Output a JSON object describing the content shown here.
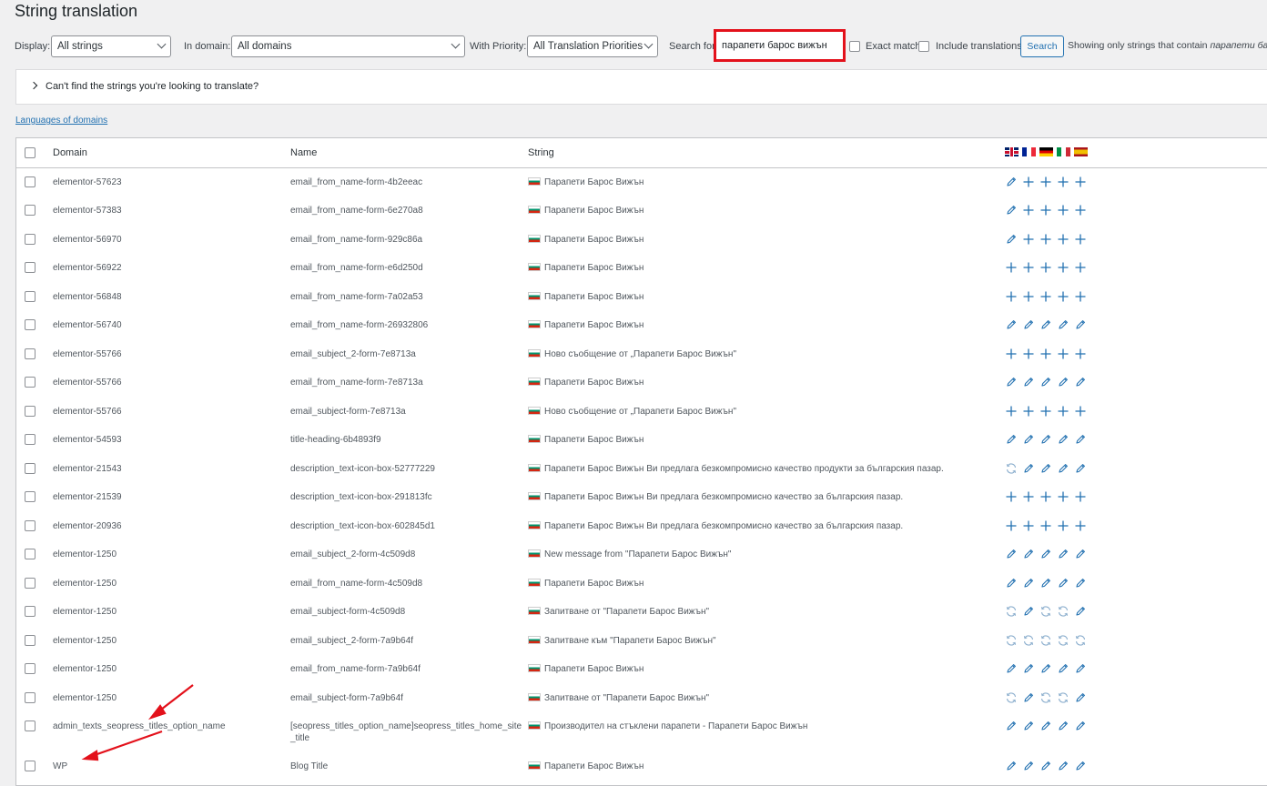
{
  "page": {
    "title": "String translation"
  },
  "filters": {
    "display_label": "Display:",
    "display_value": "All strings",
    "domain_label": "In domain:",
    "domain_value": "All domains",
    "priority_label": "With Priority:",
    "priority_value": "All Translation Priorities",
    "search_label": "Search for:",
    "search_value": "парапети барос вижън",
    "exact_match_label": "Exact match",
    "include_translations_label": "Include translations",
    "search_button": "Search",
    "result_note_prefix": "Showing only strings that contain",
    "result_note_term": "парапети ба"
  },
  "notice": {
    "text": "Can't find the strings you're looking to translate?"
  },
  "languages_link": "Languages of domains",
  "table": {
    "columns": {
      "domain": "Domain",
      "name": "Name",
      "string": "String"
    },
    "language_flags": [
      "gb-flag",
      "fr-flag",
      "de-flag",
      "it-flag",
      "es-flag"
    ],
    "rows": [
      {
        "domain": "elementor-57623",
        "name": "email_from_name-form-4b2eeac",
        "string": "Парапети Барос Вижън",
        "actions": [
          "edit",
          "add",
          "add",
          "add",
          "add"
        ]
      },
      {
        "domain": "elementor-57383",
        "name": "email_from_name-form-6e270a8",
        "string": "Парапети Барос Вижън",
        "actions": [
          "edit",
          "add",
          "add",
          "add",
          "add"
        ]
      },
      {
        "domain": "elementor-56970",
        "name": "email_from_name-form-929c86a",
        "string": "Парапети Барос Вижън",
        "actions": [
          "edit",
          "add",
          "add",
          "add",
          "add"
        ]
      },
      {
        "domain": "elementor-56922",
        "name": "email_from_name-form-e6d250d",
        "string": "Парапети Барос Вижън",
        "actions": [
          "add",
          "add",
          "add",
          "add",
          "add"
        ]
      },
      {
        "domain": "elementor-56848",
        "name": "email_from_name-form-7a02a53",
        "string": "Парапети Барос Вижън",
        "actions": [
          "add",
          "add",
          "add",
          "add",
          "add"
        ]
      },
      {
        "domain": "elementor-56740",
        "name": "email_from_name-form-26932806",
        "string": "Парапети Барос Вижън",
        "actions": [
          "edit",
          "edit",
          "edit",
          "edit",
          "edit"
        ]
      },
      {
        "domain": "elementor-55766",
        "name": "email_subject_2-form-7e8713a",
        "string": "Ново съобщение от „Парапети Барос Вижън\"",
        "actions": [
          "add",
          "add",
          "add",
          "add",
          "add"
        ]
      },
      {
        "domain": "elementor-55766",
        "name": "email_from_name-form-7e8713a",
        "string": "Парапети Барос Вижън",
        "actions": [
          "edit",
          "edit",
          "edit",
          "edit",
          "edit"
        ]
      },
      {
        "domain": "elementor-55766",
        "name": "email_subject-form-7e8713a",
        "string": "Ново съобщение от „Парапети Барос Вижън\"",
        "actions": [
          "add",
          "add",
          "add",
          "add",
          "add"
        ]
      },
      {
        "domain": "elementor-54593",
        "name": "title-heading-6b4893f9",
        "string": "Парапети Барос Вижън",
        "actions": [
          "edit",
          "edit",
          "edit",
          "edit",
          "edit"
        ]
      },
      {
        "domain": "elementor-21543",
        "name": "description_text-icon-box-52777229",
        "string": "Парапети Барос Вижън Ви предлага безкомпромисно качество продукти за българския пазар.",
        "actions": [
          "sync",
          "edit",
          "edit",
          "edit",
          "edit"
        ]
      },
      {
        "domain": "elementor-21539",
        "name": "description_text-icon-box-291813fc",
        "string": "Парапети Барос Вижън Ви предлага безкомпромисно качество за българския пазар.",
        "actions": [
          "add",
          "add",
          "add",
          "add",
          "add"
        ]
      },
      {
        "domain": "elementor-20936",
        "name": "description_text-icon-box-602845d1",
        "string": "Парапети Барос Вижън Ви предлага безкомпромисно качество за българския пазар.",
        "actions": [
          "add",
          "add",
          "add",
          "add",
          "add"
        ]
      },
      {
        "domain": "elementor-1250",
        "name": "email_subject_2-form-4c509d8",
        "string": "New message from \"Парапети Барос Вижън\"",
        "actions": [
          "edit",
          "edit",
          "edit",
          "edit",
          "edit"
        ]
      },
      {
        "domain": "elementor-1250",
        "name": "email_from_name-form-4c509d8",
        "string": "Парапети Барос Вижън",
        "actions": [
          "edit",
          "edit",
          "edit",
          "edit",
          "edit"
        ]
      },
      {
        "domain": "elementor-1250",
        "name": "email_subject-form-4c509d8",
        "string": "Запитване от \"Парапети Барос Вижън\"",
        "actions": [
          "sync",
          "edit",
          "sync",
          "sync",
          "edit"
        ]
      },
      {
        "domain": "elementor-1250",
        "name": "email_subject_2-form-7a9b64f",
        "string": "Запитване към \"Парапети Барос Вижън\"",
        "actions": [
          "sync",
          "sync",
          "sync",
          "sync",
          "sync"
        ]
      },
      {
        "domain": "elementor-1250",
        "name": "email_from_name-form-7a9b64f",
        "string": "Парапети Барос Вижън",
        "actions": [
          "edit",
          "edit",
          "edit",
          "edit",
          "edit"
        ]
      },
      {
        "domain": "elementor-1250",
        "name": "email_subject-form-7a9b64f",
        "string": "Запитване от \"Парапети Барос Вижън\"",
        "actions": [
          "sync",
          "edit",
          "sync",
          "sync",
          "edit"
        ]
      },
      {
        "domain": "admin_texts_seopress_titles_option_name",
        "name": "[seopress_titles_option_name]seopress_titles_home_site_title",
        "string": "Производител на стъклени парапети - Парапети Барос Вижън",
        "actions": [
          "edit",
          "edit",
          "edit",
          "edit",
          "edit"
        ]
      },
      {
        "domain": "WP",
        "name": "Blog Title",
        "string": "Парапети Барос Вижън",
        "actions": [
          "edit",
          "edit",
          "edit",
          "edit",
          "edit"
        ]
      }
    ]
  },
  "colors": {
    "accent": "#2271b1",
    "annotation": "#e3111b",
    "action_icon": "#2271b1"
  }
}
